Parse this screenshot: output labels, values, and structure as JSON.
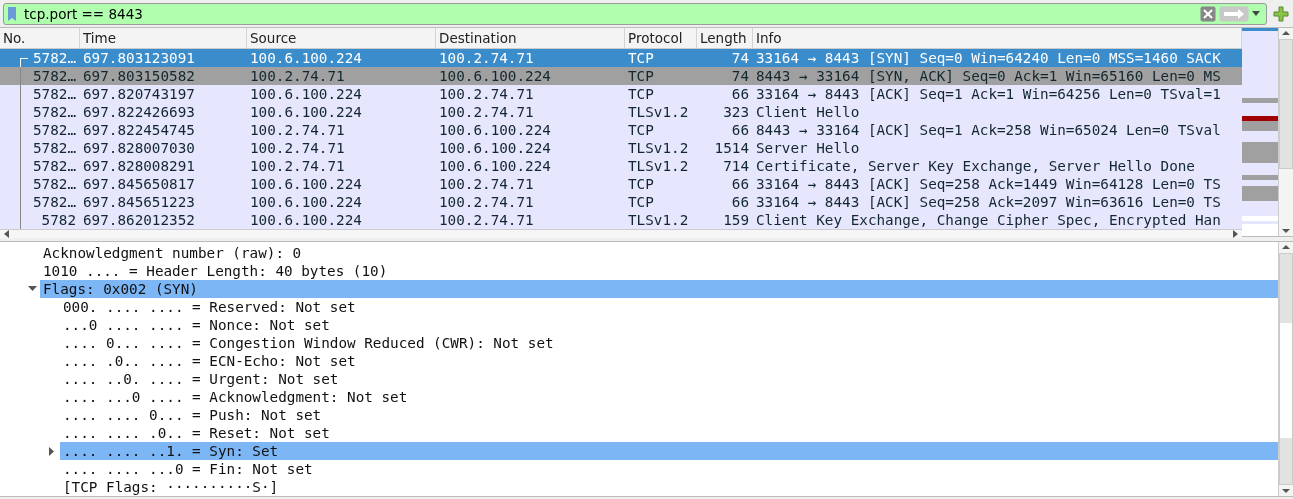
{
  "filter": {
    "value": "tcp.port == 8443"
  },
  "packet_list": {
    "columns": [
      "No.",
      "Time",
      "Source",
      "Destination",
      "Protocol",
      "Length",
      "Info"
    ],
    "rows": [
      {
        "no": "5782…",
        "time": "697.803123091",
        "source": "100.6.100.224",
        "destination": "100.2.74.71",
        "protocol": "TCP",
        "length": "74",
        "info": "33164 → 8443 [SYN] Seq=0 Win=64240 Len=0 MSS=1460 SACK",
        "selected": true,
        "highlighted": false
      },
      {
        "no": "5782…",
        "time": "697.803150582",
        "source": "100.2.74.71",
        "destination": "100.6.100.224",
        "protocol": "TCP",
        "length": "74",
        "info": "8443 → 33164 [SYN, ACK] Seq=0 Ack=1 Win=65160 Len=0 MS",
        "selected": false,
        "highlighted": true
      },
      {
        "no": "5782…",
        "time": "697.820743197",
        "source": "100.6.100.224",
        "destination": "100.2.74.71",
        "protocol": "TCP",
        "length": "66",
        "info": "33164 → 8443 [ACK] Seq=1 Ack=1 Win=64256 Len=0 TSval=1",
        "selected": false,
        "highlighted": false
      },
      {
        "no": "5782…",
        "time": "697.822426693",
        "source": "100.6.100.224",
        "destination": "100.2.74.71",
        "protocol": "TLSv1.2",
        "length": "323",
        "info": "Client Hello",
        "selected": false,
        "highlighted": false
      },
      {
        "no": "5782…",
        "time": "697.822454745",
        "source": "100.2.74.71",
        "destination": "100.6.100.224",
        "protocol": "TCP",
        "length": "66",
        "info": "8443 → 33164 [ACK] Seq=1 Ack=258 Win=65024 Len=0 TSval",
        "selected": false,
        "highlighted": false
      },
      {
        "no": "5782…",
        "time": "697.828007030",
        "source": "100.2.74.71",
        "destination": "100.6.100.224",
        "protocol": "TLSv1.2",
        "length": "1514",
        "info": "Server Hello",
        "selected": false,
        "highlighted": false
      },
      {
        "no": "5782…",
        "time": "697.828008291",
        "source": "100.2.74.71",
        "destination": "100.6.100.224",
        "protocol": "TLSv1.2",
        "length": "714",
        "info": "Certificate, Server Key Exchange, Server Hello Done",
        "selected": false,
        "highlighted": false
      },
      {
        "no": "5782…",
        "time": "697.845650817",
        "source": "100.6.100.224",
        "destination": "100.2.74.71",
        "protocol": "TCP",
        "length": "66",
        "info": "33164 → 8443 [ACK] Seq=258 Ack=1449 Win=64128 Len=0 TS",
        "selected": false,
        "highlighted": false
      },
      {
        "no": "5782…",
        "time": "697.845651223",
        "source": "100.6.100.224",
        "destination": "100.2.74.71",
        "protocol": "TCP",
        "length": "66",
        "info": "33164 → 8443 [ACK] Seq=258 Ack=2097 Win=63616 Len=0 TS",
        "selected": false,
        "highlighted": false
      },
      {
        "no": "5782",
        "time": "697.862012352",
        "source": "100.6.100.224",
        "destination": "100.2.74.71",
        "protocol": "TLSv1.2",
        "length": "159",
        "info": "Client Key Exchange, Change Cipher Spec, Encrypted Han",
        "selected": false,
        "highlighted": false
      }
    ]
  },
  "details": [
    {
      "text": "Acknowledgment number (raw): 0",
      "selected": false
    },
    {
      "text": "1010 .... = Header Length: 40 bytes (10)",
      "selected": false
    },
    {
      "text": "Flags: 0x002 (SYN)",
      "selected": true,
      "expanded": true,
      "children": [
        {
          "text": "000. .... .... = Reserved: Not set",
          "selected": false
        },
        {
          "text": "...0 .... .... = Nonce: Not set",
          "selected": false
        },
        {
          "text": ".... 0... .... = Congestion Window Reduced (CWR): Not set",
          "selected": false
        },
        {
          "text": ".... .0.. .... = ECN-Echo: Not set",
          "selected": false
        },
        {
          "text": ".... ..0. .... = Urgent: Not set",
          "selected": false
        },
        {
          "text": ".... ...0 .... = Acknowledgment: Not set",
          "selected": false
        },
        {
          "text": ".... .... 0... = Push: Not set",
          "selected": false
        },
        {
          "text": ".... .... .0.. = Reset: Not set",
          "selected": false
        },
        {
          "text": ".... .... ..1. = Syn: Set",
          "selected": true,
          "expanded": false
        },
        {
          "text": ".... .... ...0 = Fin: Not set",
          "selected": false
        },
        {
          "text": "[TCP Flags: ··········S·]",
          "selected": false
        }
      ]
    }
  ]
}
